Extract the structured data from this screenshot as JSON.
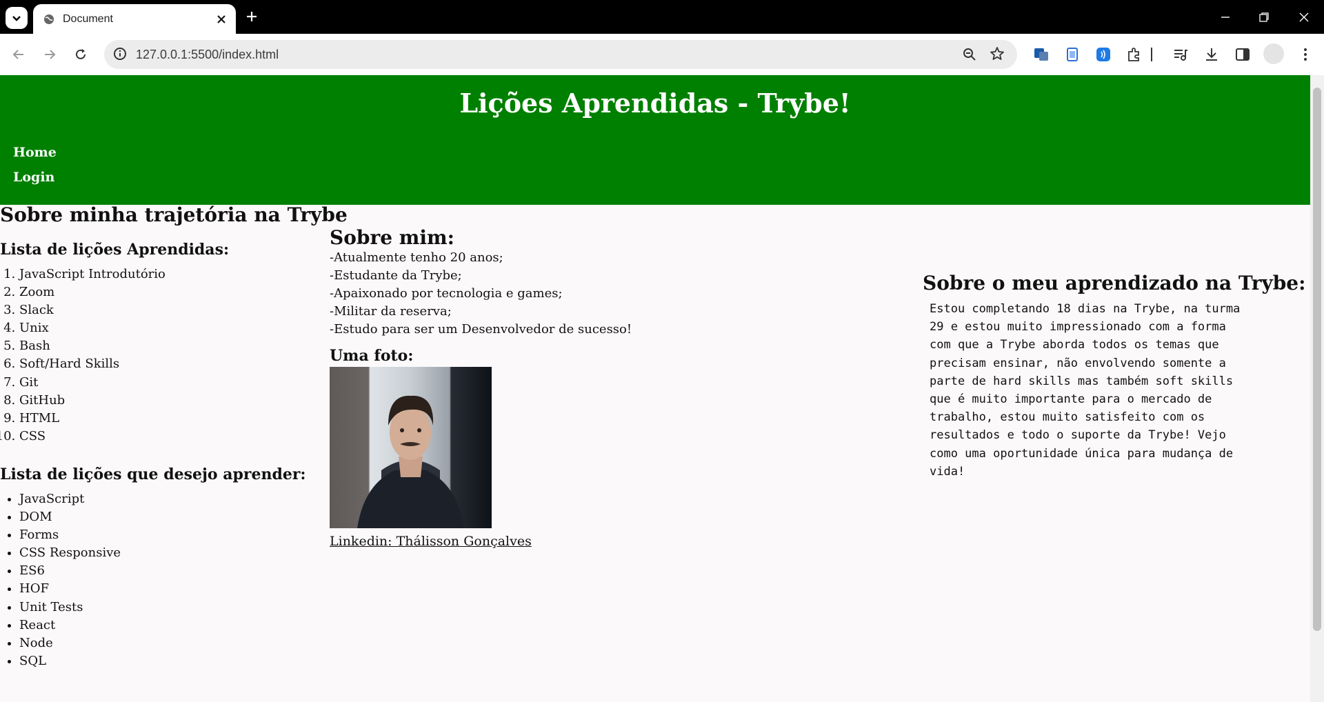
{
  "browser": {
    "tab_title": "Document",
    "url": "127.0.0.1:5500/index.html"
  },
  "site": {
    "title": "Lições Aprendidas - Trybe!",
    "nav": [
      "Home",
      "Login"
    ]
  },
  "main": {
    "heading": "Sobre minha trajetória na Trybe",
    "learned": {
      "heading": "Lista de lições Aprendidas:",
      "items": [
        "JavaScript Introdutório",
        "Zoom",
        "Slack",
        "Unix",
        "Bash",
        "Soft/Hard Skills",
        "Git",
        "GitHub",
        "HTML",
        "CSS"
      ]
    },
    "wish": {
      "heading": "Lista de lições que desejo aprender:",
      "items": [
        "JavaScript",
        "DOM",
        "Forms",
        "CSS Responsive",
        "ES6",
        "HOF",
        "Unit Tests",
        "React",
        "Node",
        "SQL"
      ]
    },
    "about": {
      "heading": "Sobre mim:",
      "lines": [
        "-Atualmente tenho 20 anos;",
        "-Estudante da Trybe;",
        "-Apaixonado por tecnologia e games;",
        "-Militar da reserva;",
        "-Estudo para ser um Desenvolvedor de sucesso!"
      ],
      "photo_heading": "Uma foto:",
      "linkedin": "Linkedin: Thálisson Gonçalves"
    },
    "learning": {
      "heading": "Sobre o meu aprendizado na Trybe:",
      "text": "Estou completando 18 dias na Trybe, na turma 29 e estou muito impressionado com a forma com que a Trybe aborda todos os temas que precisam ensinar, não envolvendo somente a parte de hard skills mas também soft skills que é muito importante para o mercado de trabalho, estou muito satisfeito com os resultados e todo o suporte da Trybe! Vejo como uma oportunidade única para mudança de vida!"
    }
  },
  "colors": {
    "header_bg": "#008000",
    "page_bg": "#fcf9fb"
  },
  "icons": [
    "tab-search-icon",
    "globe-icon",
    "close-icon",
    "plus-icon",
    "minimize-icon",
    "restore-icon",
    "close-window-icon",
    "back-icon",
    "forward-icon",
    "reload-icon",
    "site-info-icon",
    "zoom-icon",
    "star-icon",
    "extensions-icon",
    "media-icon",
    "download-icon",
    "side-panel-icon",
    "menu-dots-icon"
  ]
}
